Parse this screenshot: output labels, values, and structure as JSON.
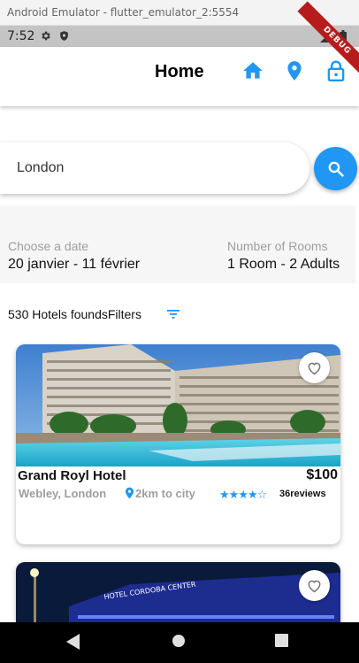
{
  "window": {
    "title": "Android Emulator - flutter_emulator_2:5554"
  },
  "status_bar": {
    "time": "7:52"
  },
  "debug_banner": "DEBUG",
  "app_bar": {
    "title": "Home",
    "icons": [
      "home-icon",
      "location-pin-icon",
      "lock-icon"
    ]
  },
  "search": {
    "value": "London",
    "icon": "search-icon"
  },
  "date": {
    "label": "Choose a date",
    "value": "20 janvier - 11 février"
  },
  "rooms": {
    "label": "Number of Rooms",
    "value": "1 Room - 2 Adults"
  },
  "results": {
    "count_text": "530 Hotels founds",
    "filters_label": "Filters"
  },
  "hotels": [
    {
      "name": "Grand Royl Hotel",
      "price": "$100",
      "location": "Webley, London",
      "distance": "2km to city",
      "rating": 4,
      "reviews": "36reviews"
    },
    {
      "sign_text": "HOTEL CORDOBA CENTER"
    }
  ],
  "colors": {
    "accent": "#2196f3",
    "debug": "#b71c1c",
    "text_secondary": "#9e9e9e"
  }
}
